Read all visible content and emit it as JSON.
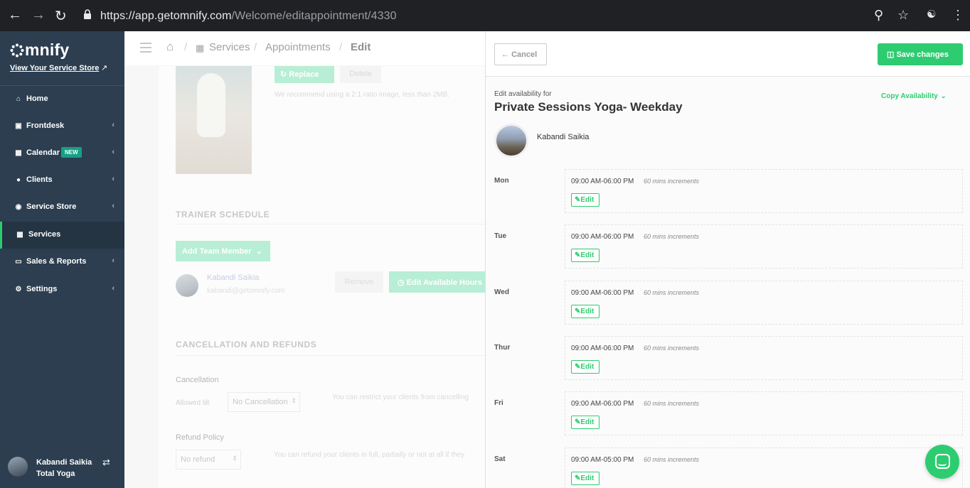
{
  "browser": {
    "url_host": "https://app.getomnify.com",
    "url_path": "/Welcome/editappointment/4330"
  },
  "sidebar": {
    "logo": "mnify",
    "store_link": "View Your Service Store",
    "items": [
      {
        "label": "Home",
        "icon": "home-icon"
      },
      {
        "label": "Frontdesk",
        "icon": "monitor-icon"
      },
      {
        "label": "Calendar",
        "icon": "calendar-icon",
        "badge": "NEW"
      },
      {
        "label": "Clients",
        "icon": "user-icon"
      },
      {
        "label": "Service Store",
        "icon": "globe-icon"
      },
      {
        "label": "Services",
        "icon": "grid-icon"
      },
      {
        "label": "Sales & Reports",
        "icon": "money-icon"
      },
      {
        "label": "Settings",
        "icon": "gear-icon"
      }
    ],
    "active": "Services",
    "user": {
      "name": "Kabandi Saikia",
      "org": "Total Yoga"
    }
  },
  "header": {
    "breadcrumb": [
      "Services",
      "Appointments",
      "Edit"
    ]
  },
  "background_form": {
    "replace_label": "Replace",
    "delete_label": "Delete",
    "image_hint": "We recommend using a 2:1 ratio image, less than 2MB.",
    "trainer_schedule_title": "TRAINER SCHEDULE",
    "add_team_member": "Add Team Member",
    "member_name": "Kabandi Saikia",
    "member_email": "kabandi@getomnify.com",
    "remove_label": "Remove",
    "edit_hours_label": "Edit Available Hours",
    "cancellation_title": "CANCELLATION AND REFUNDS",
    "cancellation_label": "Cancellation",
    "allowed_till_label": "Allowed till",
    "cancellation_value": "No Cancellation",
    "cancellation_hint": "You can restrict your clients from cancelling",
    "refund_label": "Refund Policy",
    "refund_value": "No refund",
    "refund_hint": "You can refund your clients in full, partially or not at all if they"
  },
  "drawer": {
    "cancel_label": "Cancel",
    "save_label": "Save changes",
    "edit_for_label": "Edit availability for",
    "service_title": "Private Sessions Yoga- Weekday",
    "copy_label": "Copy Availability",
    "trainer_name": "Kabandi Saikia",
    "edit_label": "Edit",
    "days": [
      {
        "day": "Mon",
        "time": "09:00 AM-06:00 PM",
        "increment": "60 mins increments"
      },
      {
        "day": "Tue",
        "time": "09:00 AM-06:00 PM",
        "increment": "60 mins increments"
      },
      {
        "day": "Wed",
        "time": "09:00 AM-06:00 PM",
        "increment": "60 mins increments"
      },
      {
        "day": "Thur",
        "time": "09:00 AM-06:00 PM",
        "increment": "60 mins increments"
      },
      {
        "day": "Fri",
        "time": "09:00 AM-06:00 PM",
        "increment": "60 mins increments"
      },
      {
        "day": "Sat",
        "time": "09:00 AM-05:00 PM",
        "increment": "60 mins increments"
      }
    ]
  },
  "colors": {
    "accent": "#2ecc71",
    "sidebar": "#2c3e50"
  }
}
